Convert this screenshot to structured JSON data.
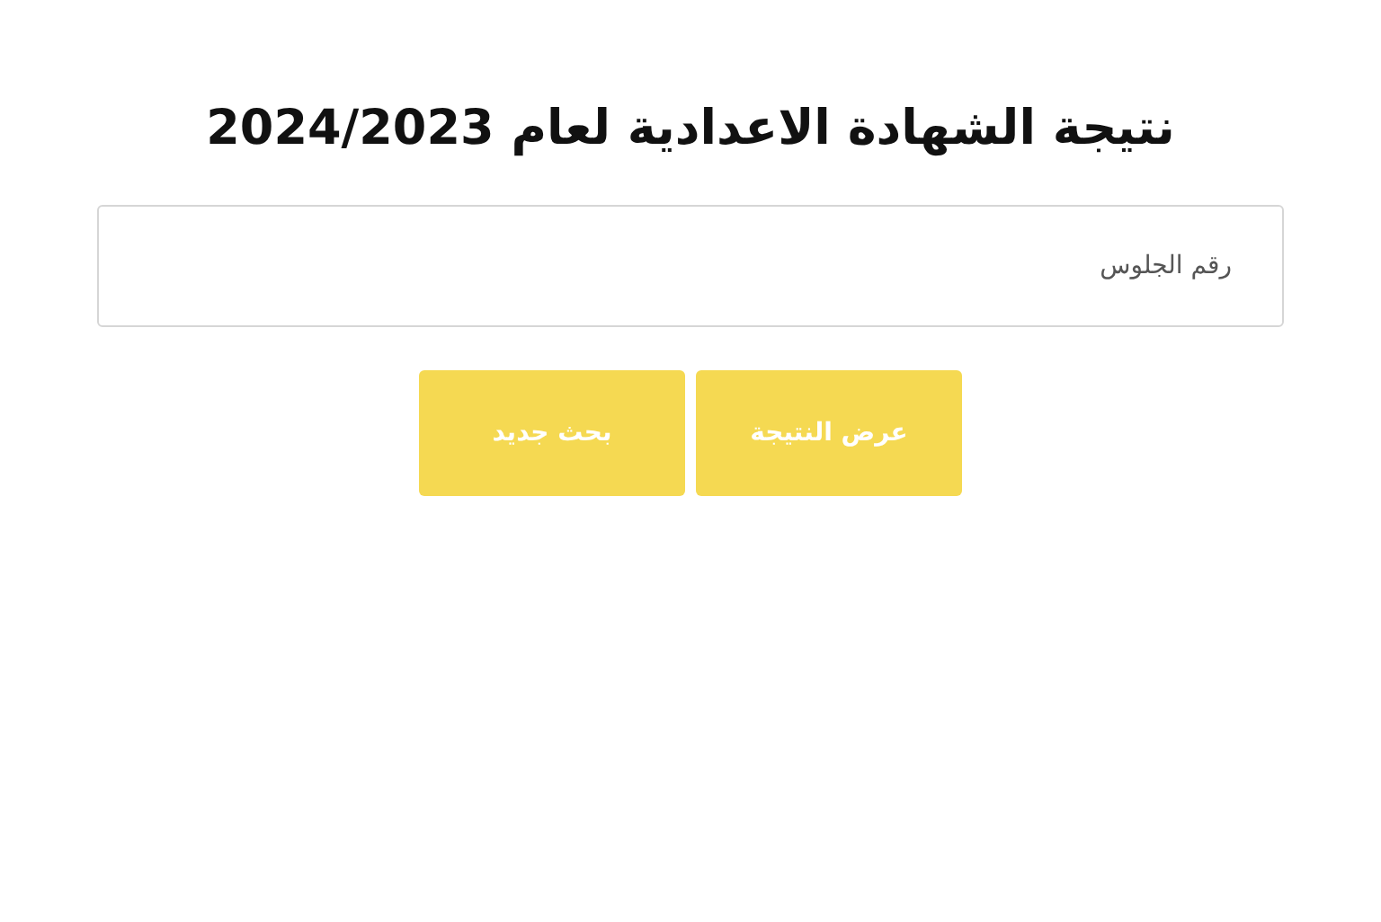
{
  "title": "نتيجة الشهادة الاعدادية لعام 2024/2023",
  "search": {
    "placeholder": "رقم الجلوس"
  },
  "buttons": [
    {
      "label": "عرض النتيجة"
    },
    {
      "label": "بحث جديد"
    }
  ]
}
